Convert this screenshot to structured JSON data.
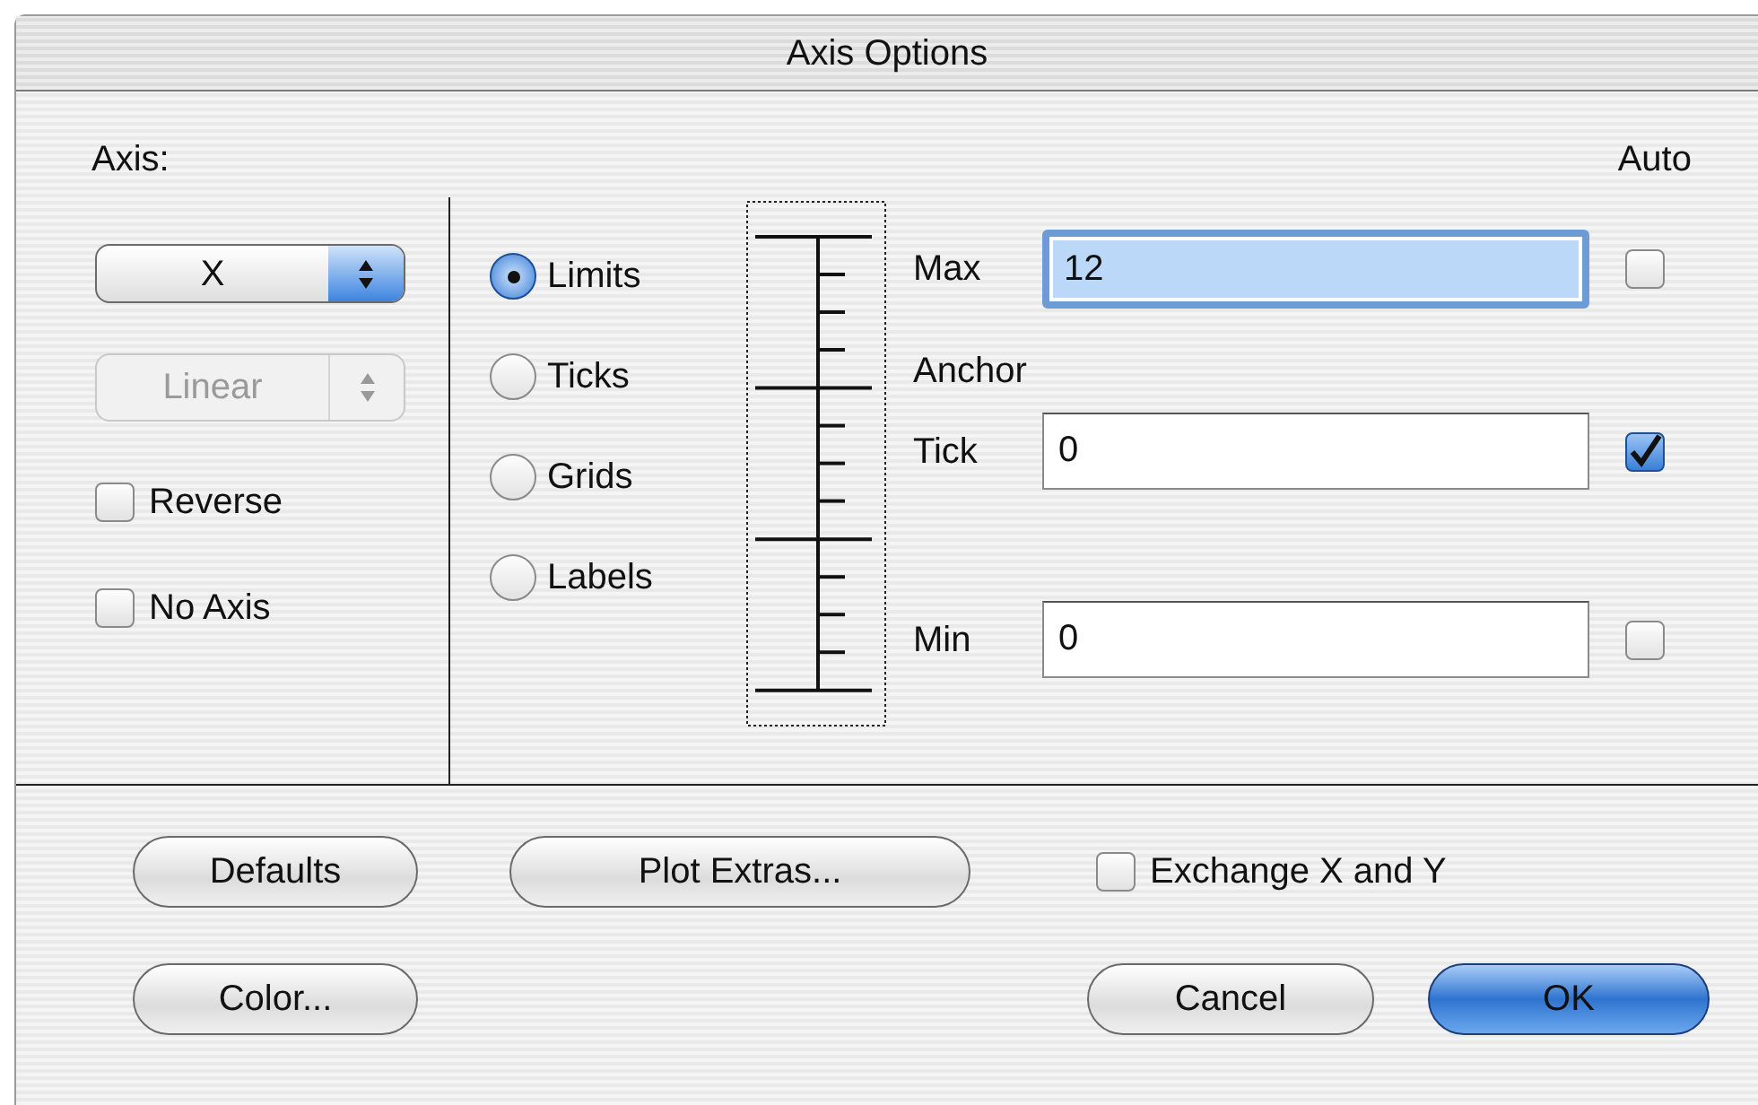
{
  "window": {
    "title": "Axis Options"
  },
  "axis_label": "Axis:",
  "auto_label": "Auto",
  "popups": [
    {
      "value": "X",
      "disabled": false
    },
    {
      "value": "Linear",
      "disabled": true
    }
  ],
  "options": [
    {
      "label": "Reverse",
      "checked": false
    },
    {
      "label": "No Axis",
      "checked": false
    }
  ],
  "modes": [
    {
      "label": "Limits",
      "selected": true
    },
    {
      "label": "Ticks",
      "selected": false
    },
    {
      "label": "Grids",
      "selected": false
    },
    {
      "label": "Labels",
      "selected": false
    }
  ],
  "fields": [
    {
      "label": "Max",
      "value": "12",
      "focused": true,
      "auto": false
    },
    {
      "heading": "Anchor",
      "label": "Tick",
      "value": "0",
      "focused": false,
      "auto": true
    },
    {
      "label": "Min",
      "value": "0",
      "focused": false,
      "auto": false
    }
  ],
  "exchange": {
    "label": "Exchange X and Y",
    "checked": false
  },
  "buttons": [
    {
      "label": "Defaults",
      "default": false
    },
    {
      "label": "Plot Extras...",
      "default": false
    },
    {
      "label": "Color...",
      "default": false
    },
    {
      "label": "Cancel",
      "default": false
    },
    {
      "label": "OK",
      "default": true
    }
  ]
}
